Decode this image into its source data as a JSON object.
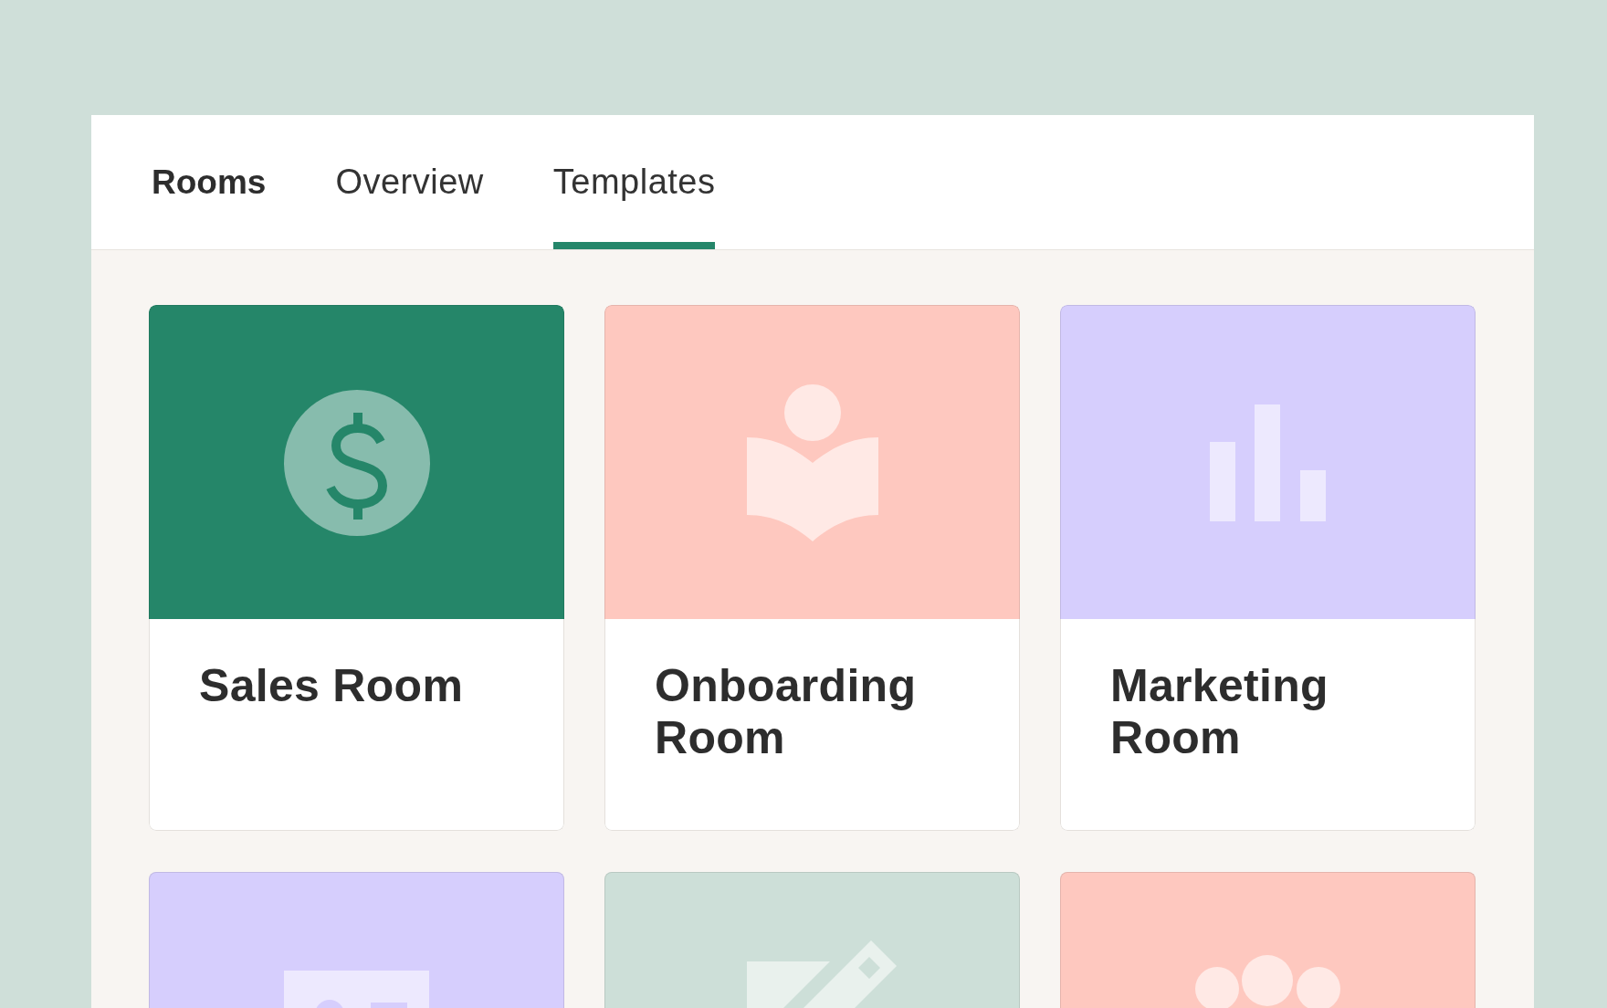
{
  "header": {
    "title": "Rooms"
  },
  "tabs": [
    {
      "label": "Overview",
      "selected": false
    },
    {
      "label": "Templates",
      "selected": true
    }
  ],
  "cards": [
    {
      "kind": "dollar",
      "color": "#258669",
      "title": "Sales Room"
    },
    {
      "kind": "book",
      "color": "#fec8bf",
      "title": "Onboarding Room"
    },
    {
      "kind": "chart",
      "color": "#d6cefd",
      "title": "Marketing Room"
    },
    {
      "kind": "profile",
      "color": "#d6cefd"
    },
    {
      "kind": "pencil",
      "color": "#cddfd8"
    },
    {
      "kind": "circles",
      "color": "#fec8bf"
    }
  ]
}
